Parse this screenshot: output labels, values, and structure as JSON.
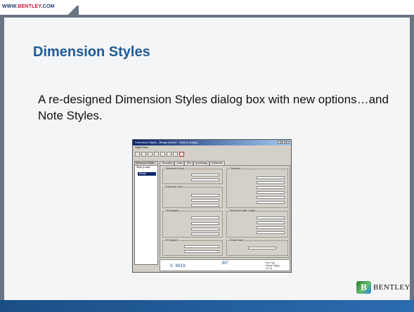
{
  "header": {
    "site_url_prefix": "WWW.",
    "site_url_brand": "BENTLEY",
    "site_url_suffix": ".COM"
  },
  "slide": {
    "title": "Dimension Styles",
    "body": "A re-designed Dimension Styles dialog box with new options…and Note Styles."
  },
  "dialog": {
    "title": "Dimension Styles - Bridge (Active - Style (Locally))",
    "menu": "Style   View",
    "tree_header": "Dimension Styles",
    "tree_item_1": "Style (Local)",
    "tree_item_selected": "Bridge",
    "tabs": [
      "Geometry",
      "Units",
      "Text",
      "Symbology",
      "Advanced"
    ],
    "groups": {
      "dimension_lines": "Dimension Lines",
      "tolerance": "Tolerance",
      "extension_lines": "Extension Lines",
      "terminators": "Terminators",
      "dimension_with_leader": "Dimension With Leader",
      "fit_options": "Fit Options",
      "center_mark": "Center Mark"
    },
    "preview": {
      "value_1": "0.9819",
      "value_2": "60°",
      "note_line_1": "Xxx Yyy",
      "note_line_2": "Xxxxx Yyyyy",
      "note_line_3": "Xx Yy"
    }
  },
  "logo": {
    "mark": "B",
    "text": "BENTLEY"
  },
  "colors": {
    "title": "#1f5a96",
    "frame": "#6a7583",
    "footer": "#1c5693",
    "brand_red": "#c8102e"
  }
}
